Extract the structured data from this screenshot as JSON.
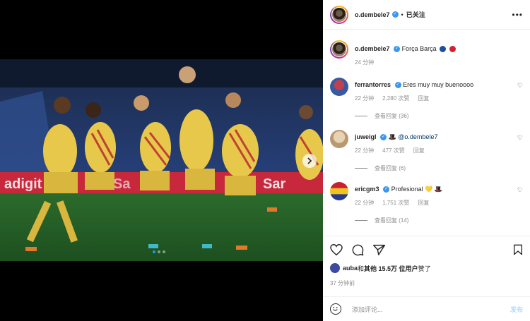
{
  "post": {
    "author": "o.dembele7",
    "separator": "•",
    "follow_label": "已关注",
    "more_icon": "more-horizontal-icon",
    "caption_text": "Força Barça",
    "caption_time": "24 分钟",
    "carousel": {
      "slides": 3,
      "active": 1
    }
  },
  "comments": [
    {
      "user": "ferrantorres",
      "text": "Eres muy muy buenoooo",
      "time": "22 分钟",
      "likes": "2,280 次赞",
      "reply": "回复",
      "view_replies": "查看回复 (36)"
    },
    {
      "user": "juweigl",
      "text": "@o.dembele7",
      "time": "22 分钟",
      "likes": "477 次赞",
      "reply": "回复",
      "view_replies": "查看回复 (6)"
    },
    {
      "user": "ericgm3",
      "text": "Profesional",
      "time": "22 分钟",
      "likes": "1,751 次赞",
      "reply": "回复",
      "view_replies": "查看回复 (14)"
    }
  ],
  "actions": {
    "liked_by_user": "auba",
    "liked_by_mid": " 和 ",
    "liked_by_rest": "其他 15.5万 位用户",
    "liked_by_end": " 赞了",
    "post_time": "37 分钟前"
  },
  "add_comment": {
    "placeholder": "添加评论...",
    "post_label": "发布"
  },
  "colors": {
    "verified": "#3897f0",
    "link": "#00376b",
    "post_disabled": "#b3dbff"
  }
}
